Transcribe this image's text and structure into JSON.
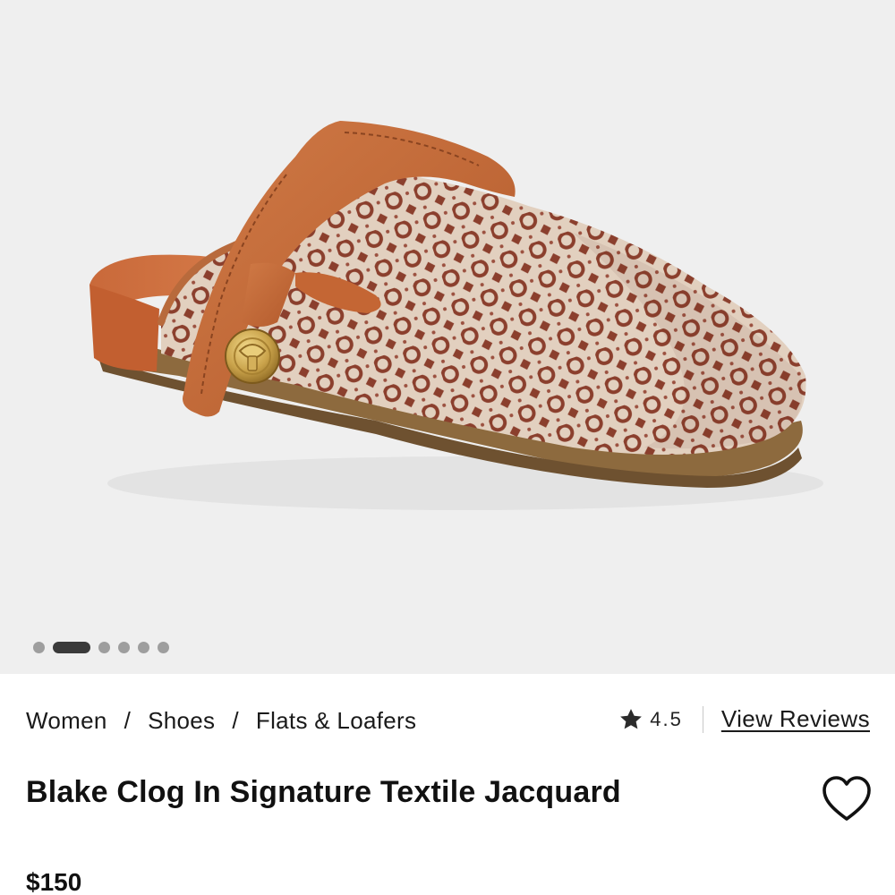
{
  "gallery": {
    "image_label": "shoe-image",
    "slide_count": 6,
    "active_slide": 2
  },
  "breadcrumb": {
    "items": [
      "Women",
      "Shoes",
      "Flats & Loafers"
    ],
    "separator": "/"
  },
  "rating": {
    "icon": "star-icon",
    "value": "4.5",
    "reviews_link": "View Reviews"
  },
  "product": {
    "title": "Blake Clog In Signature Textile Jacquard",
    "price": "$150",
    "wishlist_icon": "heart-outline-icon"
  },
  "colors": {
    "leather": "#c36a3a",
    "jacquard_base": "#e4d3c2",
    "jacquard_pattern": "#8a3d2c",
    "hardware": "#c9a24a",
    "gallery_bg": "#efefef",
    "active_dot": "#3a3a3a",
    "inactive_dot": "#9e9e9e"
  }
}
